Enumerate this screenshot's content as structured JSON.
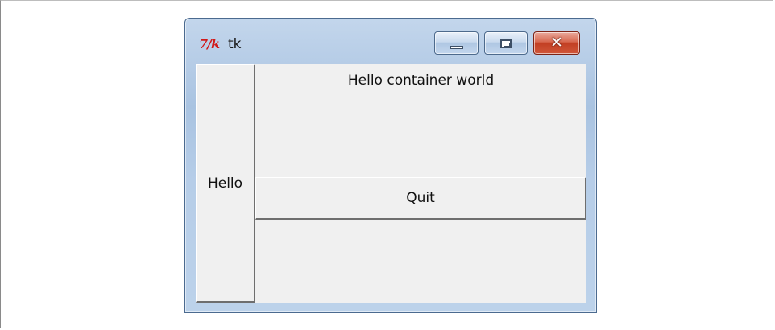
{
  "window": {
    "title": "tk",
    "logo_text": "7/k",
    "title_bar_color": "#b6cde8",
    "close_button_color": "#c23e22"
  },
  "controls": {
    "minimize_icon": "minimize-icon",
    "maximize_icon": "maximize-icon",
    "close_icon": "close-icon",
    "close_glyph": "✕"
  },
  "content": {
    "hello_button_label": "Hello",
    "message": "Hello container world",
    "quit_button_label": "Quit"
  }
}
